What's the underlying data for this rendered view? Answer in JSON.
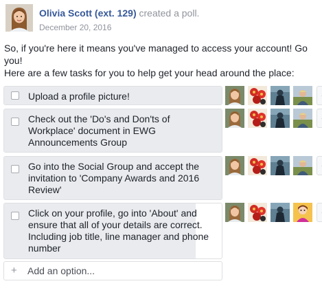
{
  "post": {
    "author_name": "Olivia Scott (ext. 129)",
    "action": " created a poll.",
    "timestamp": "December 20, 2016",
    "text_line1": "So, if you're here it means you've managed to access your account! Go you!",
    "text_line2": "Here are a few tasks for you to help get your head around the place:"
  },
  "poll": {
    "options": [
      {
        "label": "Upload a profile picture!",
        "vote_fill": 1.0,
        "voters": [
          "avatar-woman-smiling",
          "avatar-red-flowers",
          "avatar-dark-figure",
          "avatar-outdoor-man"
        ],
        "more": "+"
      },
      {
        "label": "Check out the 'Do's and Don'ts of Workplace' document in EWG Announcements Group",
        "vote_fill": 1.0,
        "voters": [
          "avatar-woman-smiling",
          "avatar-red-flowers",
          "avatar-dark-figure",
          "avatar-outdoor-man"
        ],
        "more": "+"
      },
      {
        "label": "Go into the Social Group and accept the invitation to 'Company Awards and 2016 Review'",
        "vote_fill": 1.0,
        "voters": [
          "avatar-woman-smiling",
          "avatar-red-flowers",
          "avatar-dark-figure",
          "avatar-outdoor-man"
        ],
        "more": "+"
      },
      {
        "label": "Click on your profile, go into 'About' and ensure that all of your details are correct. Including job title, line manager and phone number",
        "vote_fill": 0.88,
        "voters": [
          "avatar-woman-smiling",
          "avatar-red-flowers",
          "avatar-dark-figure",
          "avatar-cartoon-woman"
        ],
        "more": "+"
      }
    ],
    "add_option": {
      "icon": "+",
      "placeholder": "Add an option..."
    }
  },
  "colors": {
    "link": "#365899",
    "muted": "#90949c",
    "vote_fill": "#e9ebee",
    "border": "#dddfe2"
  }
}
